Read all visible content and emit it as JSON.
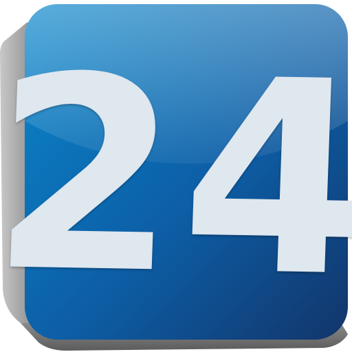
{
  "icon": {
    "number": "24",
    "name": "clock-24-icon",
    "colors": {
      "face_top": "#0a88cc",
      "face_bottom": "#12356a",
      "side": "#9a9a9a",
      "digit": "#dfe7ef"
    }
  }
}
